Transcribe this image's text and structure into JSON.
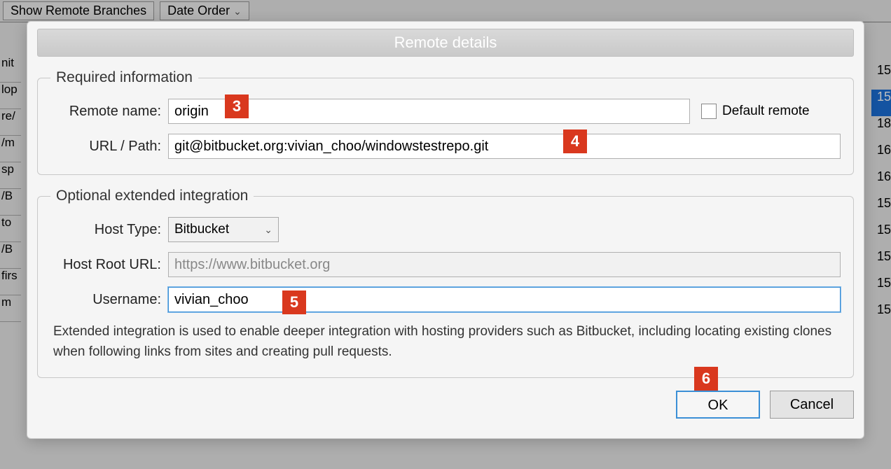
{
  "background": {
    "toolbar_show_remote": "Show Remote Branches",
    "toolbar_date_order": "Date Order",
    "left_items": [
      "nit",
      "lop",
      "re/",
      "/m",
      "sp",
      "/B",
      "to",
      "/B",
      "firs",
      "m"
    ],
    "right_items": [
      "15",
      "15",
      "18",
      "16",
      "16",
      "15",
      "15",
      "15",
      "15",
      "15"
    ]
  },
  "dialog": {
    "title": "Remote details",
    "required": {
      "legend": "Required information",
      "remote_name_label": "Remote name:",
      "remote_name_value": "origin",
      "default_remote_label": "Default remote",
      "default_remote_checked": false,
      "url_label": "URL / Path:",
      "url_value": "git@bitbucket.org:vivian_choo/windowstestrepo.git"
    },
    "optional": {
      "legend": "Optional extended integration",
      "host_type_label": "Host Type:",
      "host_type_value": "Bitbucket",
      "host_root_label": "Host Root URL:",
      "host_root_value": "https://www.bitbucket.org",
      "username_label": "Username:",
      "username_value": "vivian_choo",
      "hint": "Extended integration is used to enable deeper integration with hosting providers such as Bitbucket, including locating existing clones when following links from sites and creating pull requests."
    },
    "buttons": {
      "ok": "OK",
      "cancel": "Cancel"
    }
  },
  "callouts": [
    "3",
    "4",
    "5",
    "6"
  ]
}
